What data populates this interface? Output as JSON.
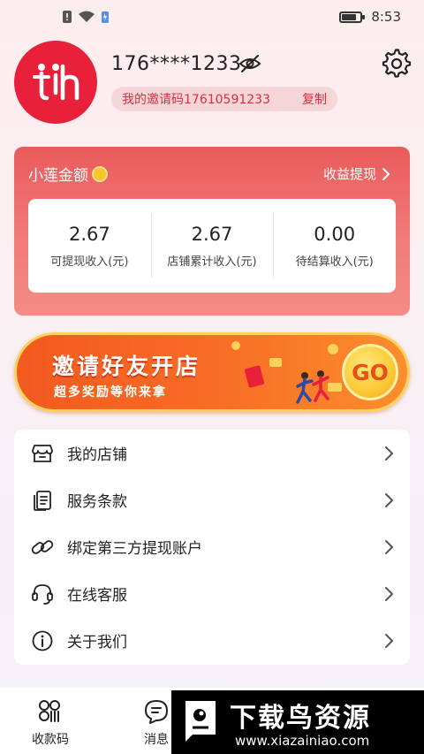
{
  "status_bar": {
    "time": "8:53"
  },
  "profile": {
    "phone": "176****1233",
    "invite_label": "我的邀请码17610591233",
    "copy_label": "复制"
  },
  "earnings": {
    "title": "小莲金额",
    "withdraw_label": "收益提现",
    "stats": [
      {
        "value": "2.67",
        "label": "可提现收入(元)"
      },
      {
        "value": "2.67",
        "label": "店铺累计收入(元)"
      },
      {
        "value": "0.00",
        "label": "待结算收入(元)"
      }
    ]
  },
  "banner": {
    "title": "邀请好友开店",
    "subtitle": "超多奖励等你来拿",
    "go_label": "GO"
  },
  "menu": {
    "items": [
      {
        "label": "我的店铺",
        "icon": "store-icon"
      },
      {
        "label": "服务条款",
        "icon": "document-icon"
      },
      {
        "label": "绑定第三方提现账户",
        "icon": "link-icon"
      },
      {
        "label": "在线客服",
        "icon": "headset-icon"
      },
      {
        "label": "关于我们",
        "icon": "info-icon"
      }
    ]
  },
  "bottom_nav": {
    "items": [
      {
        "label": "收款码",
        "icon": "qr-code-icon"
      },
      {
        "label": "消息",
        "icon": "message-icon"
      }
    ]
  },
  "watermark": {
    "title": "下载鸟资源",
    "url": "www.xiazainiao.com"
  },
  "colors": {
    "brand_red": "#e8203a",
    "accent_text": "#d53140",
    "banner_orange": "#f86c25"
  }
}
